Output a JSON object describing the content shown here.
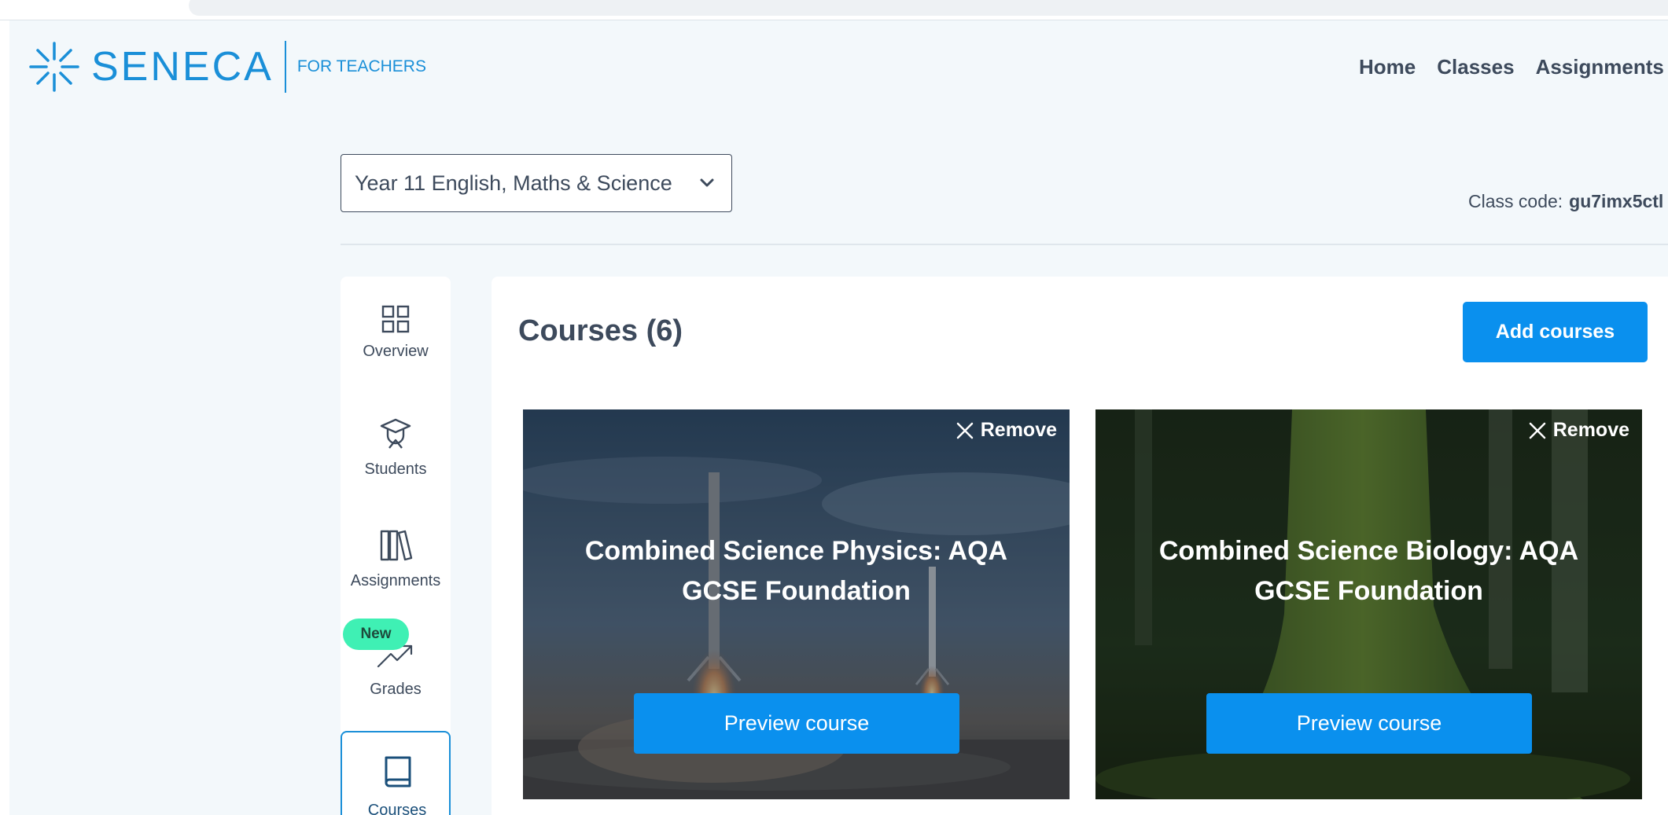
{
  "brand": {
    "name": "SENECA",
    "sub": "FOR TEACHERS",
    "color": "#1a8fd8"
  },
  "topnav": [
    "Home",
    "Classes",
    "Assignments"
  ],
  "class_selector": {
    "value": "Year 11 English, Maths & Science"
  },
  "class_code": {
    "label": "Class code:",
    "value": "gu7imx5ctl"
  },
  "sidenav": {
    "items": [
      {
        "label": "Overview",
        "icon": "grid-icon"
      },
      {
        "label": "Students",
        "icon": "graduate-icon"
      },
      {
        "label": "Assignments",
        "icon": "books-icon"
      },
      {
        "label": "Grades",
        "icon": "trend-up-icon",
        "badge": "New"
      },
      {
        "label": "Courses",
        "icon": "book-icon",
        "active": true
      }
    ]
  },
  "main": {
    "title": "Courses (6)",
    "add_button": "Add courses",
    "accent": "#0a90ee",
    "courses": [
      {
        "title_line1": "Combined Science Physics: AQA",
        "title_line2": "GCSE Foundation",
        "remove_label": "Remove",
        "preview_label": "Preview course"
      },
      {
        "title_line1": "Combined Science Biology: AQA",
        "title_line2": "GCSE Foundation",
        "remove_label": "Remove",
        "preview_label": "Preview course"
      }
    ]
  }
}
